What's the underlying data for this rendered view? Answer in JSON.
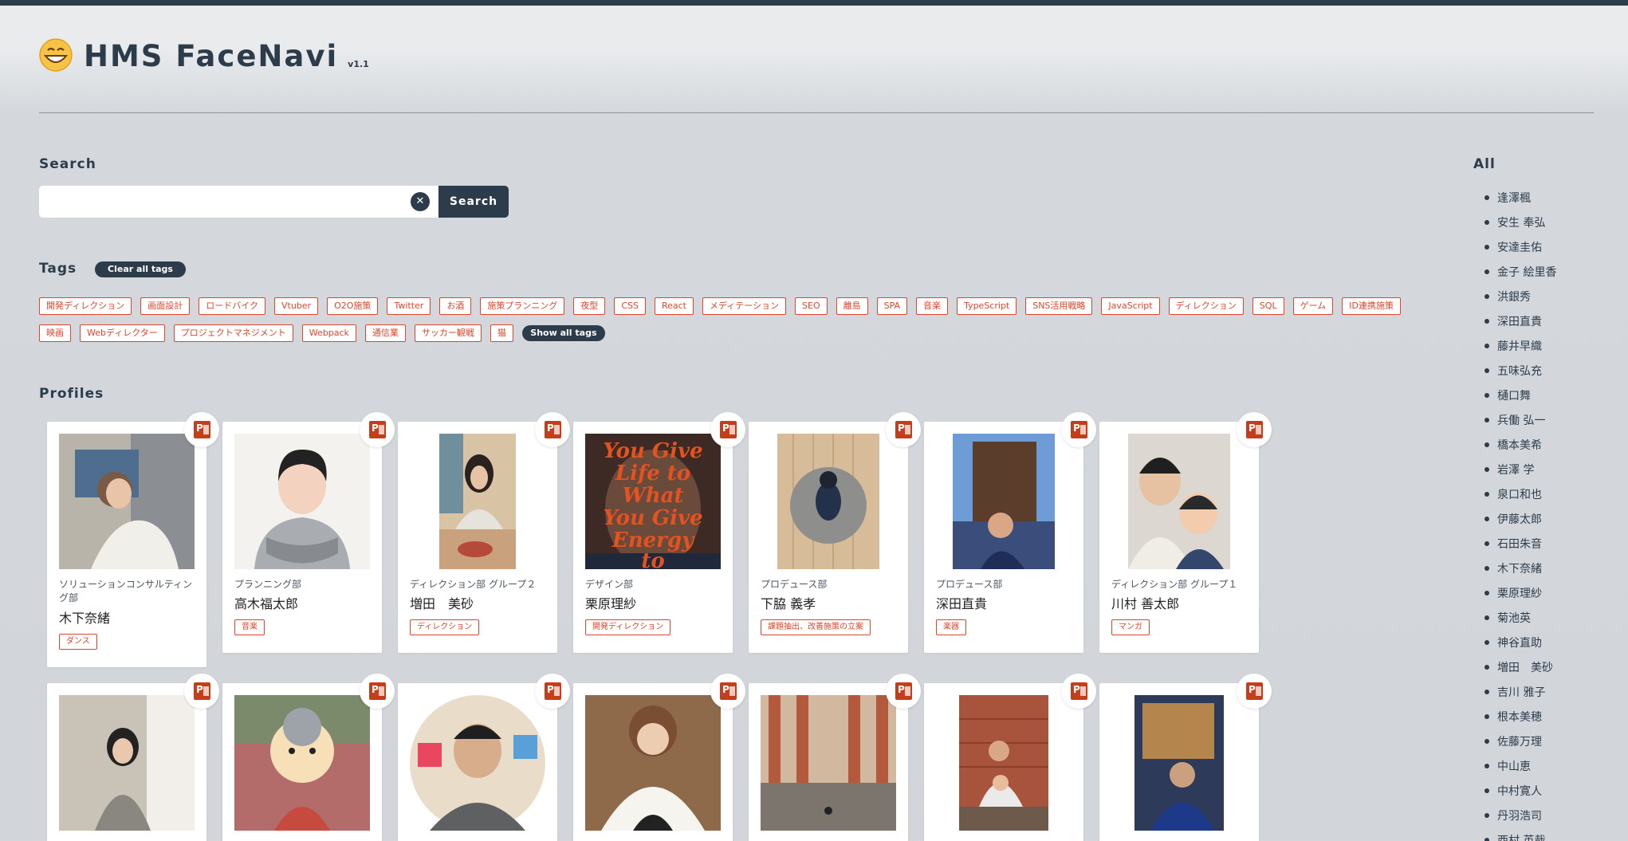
{
  "app": {
    "title": "HMS FaceNavi",
    "version": "v1.1"
  },
  "search": {
    "title": "Search",
    "value": "",
    "button_label": "Search",
    "clear_icon": "close-icon"
  },
  "tags_section": {
    "title": "Tags",
    "clear_label": "Clear all tags",
    "show_all_label": "Show all tags",
    "tags": [
      "開発ディレクション",
      "画面設計",
      "ロードバイク",
      "Vtuber",
      "O2O施策",
      "Twitter",
      "お酒",
      "施策プランニング",
      "夜型",
      "CSS",
      "React",
      "メディテーション",
      "SEO",
      "離島",
      "SPA",
      "音楽",
      "TypeScript",
      "SNS活用戦略",
      "JavaScript",
      "ディレクション",
      "SQL",
      "ゲーム",
      "ID連携施策",
      "映画",
      "Webディレクター",
      "プロジェクトマネジメント",
      "Webpack",
      "通信業",
      "サッカー観戦",
      "猫"
    ]
  },
  "profiles": {
    "title": "Profiles",
    "cards": [
      {
        "dept": "ソリューションコンサルティング部",
        "name": "木下奈緒",
        "tag": "ダンス"
      },
      {
        "dept": "プランニング部",
        "name": "高木福太郎",
        "tag": "音楽"
      },
      {
        "dept": "ディレクション部 グループ２",
        "name": "増田　美砂",
        "tag": "ディレクション"
      },
      {
        "dept": "デザイン部",
        "name": "栗原理紗",
        "tag": "開発ディレクション"
      },
      {
        "dept": "プロデュース部",
        "name": "下脇 義孝",
        "tag": "課題抽出、改善施策の立案"
      },
      {
        "dept": "プロデュース部",
        "name": "深田直貴",
        "tag": "楽器"
      },
      {
        "dept": "ディレクション部 グループ１",
        "name": "川村 善太郎",
        "tag": "マンガ"
      }
    ],
    "photo_text": "You Give Life to What You Give Energy to",
    "ppt_icon": "powerpoint-icon"
  },
  "all_section": {
    "title": "All",
    "names": [
      "逢澤楓",
      "安生 奉弘",
      "安達圭佑",
      "金子 絵里香",
      "洪銀秀",
      "深田直貴",
      "藤井早織",
      "五味弘充",
      "樋口舞",
      "兵働 弘一",
      "橋本美希",
      "岩澤 学",
      "泉口和也",
      "伊藤太郎",
      "石田朱音",
      "木下奈緒",
      "栗原理紗",
      "菊池英",
      "神谷直助",
      "増田　美砂",
      "吉川 雅子",
      "根本美穂",
      "佐藤万理",
      "中山恵",
      "中村寛人",
      "丹羽浩司",
      "西村 英哉"
    ]
  },
  "colors": {
    "accent": "#e0442b",
    "dark": "#2d3c4b"
  }
}
